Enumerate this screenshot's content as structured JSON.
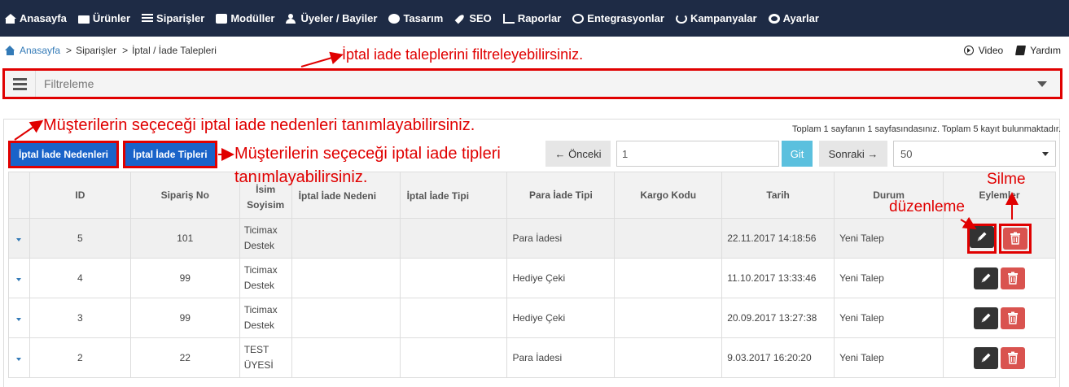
{
  "nav": {
    "items": [
      {
        "label": "Anasayfa",
        "icon": "home-icon"
      },
      {
        "label": "Ürünler",
        "icon": "folder-icon"
      },
      {
        "label": "Siparişler",
        "icon": "list-icon"
      },
      {
        "label": "Modüller",
        "icon": "box-icon"
      },
      {
        "label": "Üyeler / Bayiler",
        "icon": "users-icon"
      },
      {
        "label": "Tasarım",
        "icon": "palette-icon"
      },
      {
        "label": "SEO",
        "icon": "rocket-icon"
      },
      {
        "label": "Raporlar",
        "icon": "chart-icon"
      },
      {
        "label": "Entegrasyonlar",
        "icon": "sync-icon"
      },
      {
        "label": "Kampanyalar",
        "icon": "refresh-icon"
      },
      {
        "label": "Ayarlar",
        "icon": "gear-icon"
      }
    ]
  },
  "breadcrumb": {
    "home": "Anasayfa",
    "sep": ">",
    "items": [
      "Siparişler",
      "İptal / İade Talepleri"
    ]
  },
  "help": {
    "video": "Video",
    "help": "Yardım"
  },
  "filter": {
    "label": "Filtreleme"
  },
  "buttons": {
    "reasons": "İptal İade Nedenleri",
    "types": "İptal İade Tipleri"
  },
  "pagination": {
    "info": "Toplam 1 sayfanın 1 sayfasındasınız. Toplam 5 kayıt bulunmaktadır.",
    "prev": "← Önceki",
    "page": "1",
    "go": "Git",
    "next": "Sonraki →",
    "page_size": "50"
  },
  "table": {
    "headers": {
      "id": "ID",
      "order_no": "Sipariş No",
      "name_1": "İsim",
      "name_2": "Soyisim",
      "reason": "İptal İade Nedeni",
      "type": "İptal İade Tipi",
      "refund_type": "Para İade Tipi",
      "cargo": "Kargo Kodu",
      "date": "Tarih",
      "status": "Durum",
      "actions": "Eylemler"
    },
    "rows": [
      {
        "id": "5",
        "order_no": "101",
        "name_1": "Ticimax",
        "name_2": "Destek",
        "reason": "",
        "type": "",
        "refund_type": "Para İadesi",
        "cargo": "",
        "date": "22.11.2017 14:18:56",
        "status": "Yeni Talep"
      },
      {
        "id": "4",
        "order_no": "99",
        "name_1": "Ticimax",
        "name_2": "Destek",
        "reason": "",
        "type": "",
        "refund_type": "Hediye Çeki",
        "cargo": "",
        "date": "11.10.2017 13:33:46",
        "status": "Yeni Talep"
      },
      {
        "id": "3",
        "order_no": "99",
        "name_1": "Ticimax",
        "name_2": "Destek",
        "reason": "",
        "type": "",
        "refund_type": "Hediye Çeki",
        "cargo": "",
        "date": "20.09.2017 13:27:38",
        "status": "Yeni Talep"
      },
      {
        "id": "2",
        "order_no": "22",
        "name_1": "TEST",
        "name_2": "ÜYESİ",
        "reason": "",
        "type": "",
        "refund_type": "Para İadesi",
        "cargo": "",
        "date": "9.03.2017 16:20:20",
        "status": "Yeni Talep"
      }
    ]
  },
  "annotations": {
    "filter": "İptal iade taleplerini filtreleyebilirsiniz.",
    "reasons": "Müşterilerin seçeceği iptal iade nedenleri tanımlayabilirsiniz.",
    "types_line1": "Müşterilerin seçeceği iptal iade tipleri",
    "types_line2": "tanımlayabilirsiniz.",
    "edit": "düzenleme",
    "delete": "Silme"
  },
  "colors": {
    "navbar": "#1e2b45",
    "annotation": "#e00000",
    "primary": "#1a63c9",
    "danger": "#d9534f",
    "info": "#5bc0de"
  }
}
